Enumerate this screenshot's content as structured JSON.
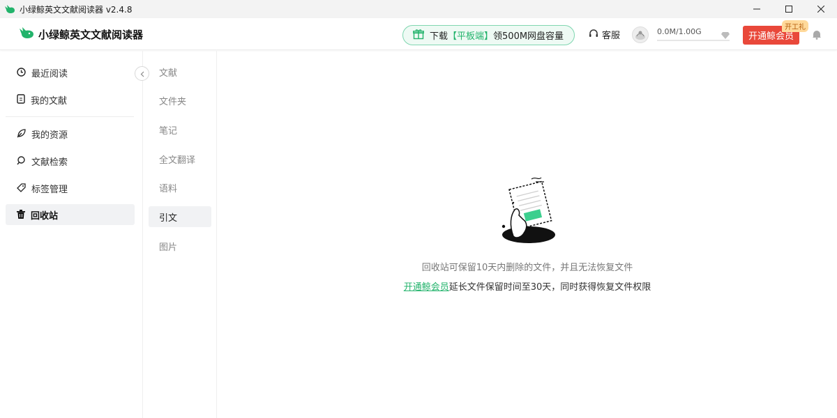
{
  "window": {
    "title": "小绿鲸英文文献阅读器 v2.4.8"
  },
  "header": {
    "logo_text": "小绿鲸英文文献阅读器",
    "promo": {
      "prefix": "下载",
      "highlight": "【平板端】",
      "suffix": "领500M网盘容量"
    },
    "service_label": "客服",
    "storage_text": "0.0M/1.00G",
    "storage_used_fraction": 0,
    "vip_button_label": "开通鲸会员",
    "vip_badge": "开工礼"
  },
  "sidebar": {
    "items": [
      {
        "label": "最近阅读",
        "icon": "clock-icon"
      },
      {
        "label": "我的文献",
        "icon": "document-icon"
      },
      {
        "label": "我的资源",
        "icon": "feather-icon"
      },
      {
        "label": "文献检索",
        "icon": "search-icon"
      },
      {
        "label": "标签管理",
        "icon": "tag-icon"
      },
      {
        "label": "回收站",
        "icon": "trash-icon",
        "active": true
      }
    ]
  },
  "subnav": {
    "items": [
      {
        "label": "文献"
      },
      {
        "label": "文件夹"
      },
      {
        "label": "笔记"
      },
      {
        "label": "全文翻译"
      },
      {
        "label": "语料"
      },
      {
        "label": "引文",
        "active": true
      },
      {
        "label": "图片"
      }
    ]
  },
  "main": {
    "empty_message": "回收站可保留10天内删除的文件，并且无法恢复文件",
    "upsell_link": "开通鲸会员",
    "upsell_text": "延长文件保留时间至30天，同时获得恢复文件权限"
  },
  "colors": {
    "accent_green": "#22b36b",
    "vip_red": "#e9483a"
  }
}
